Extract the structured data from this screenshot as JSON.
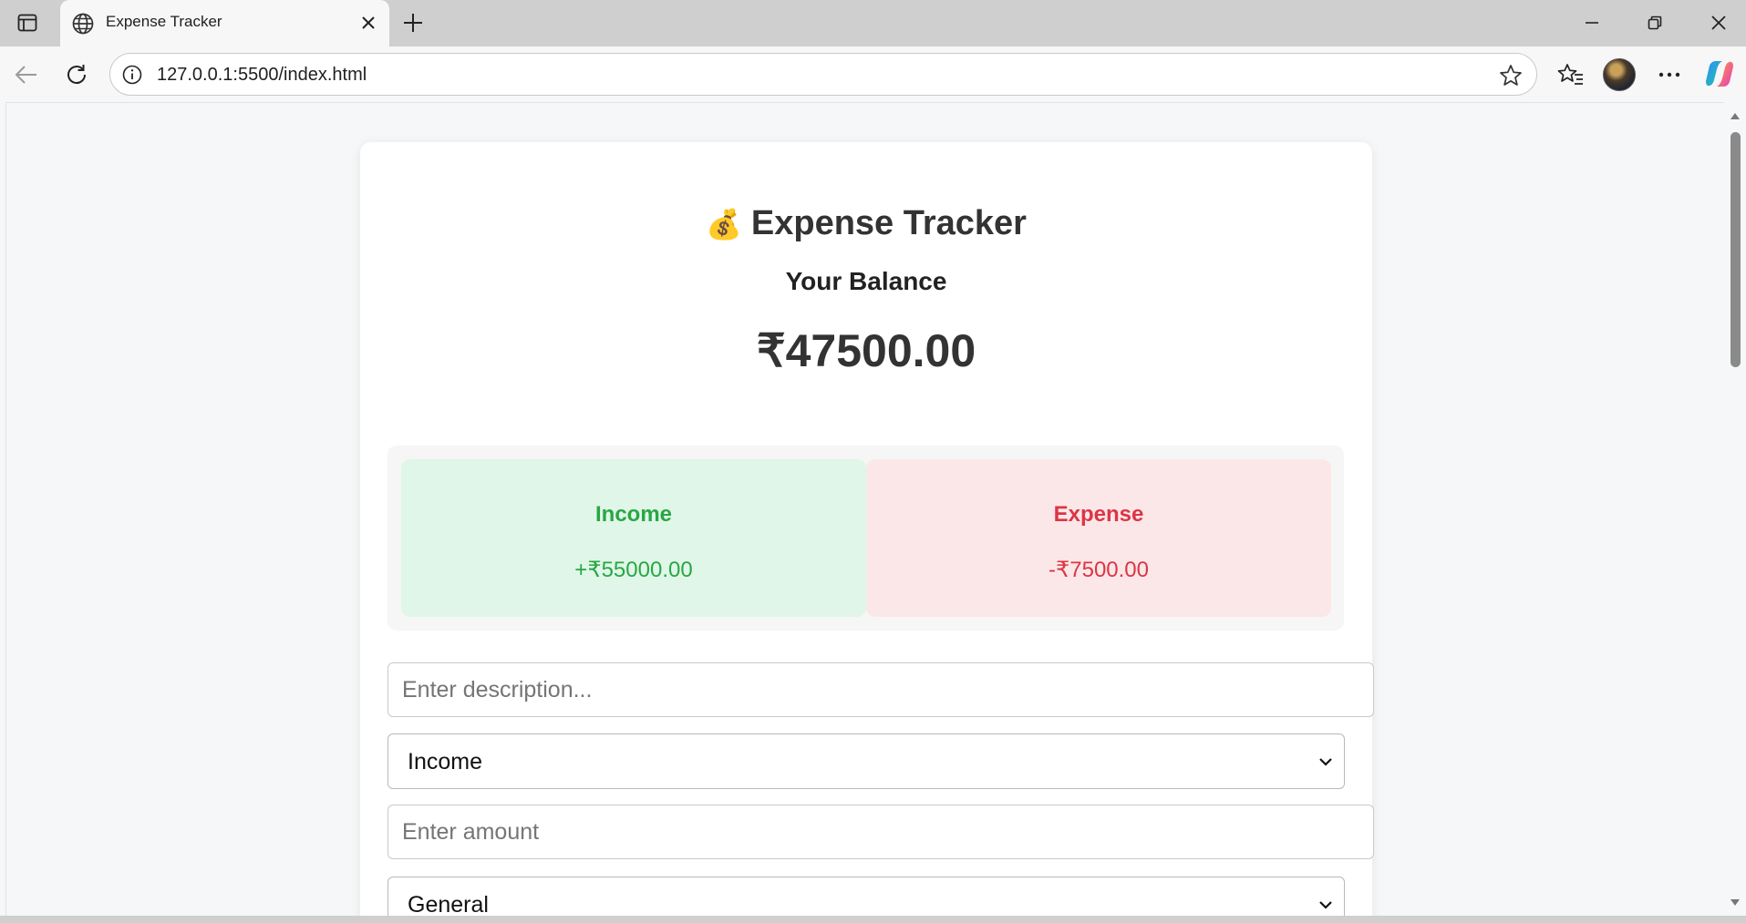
{
  "browser": {
    "tab_title": "Expense Tracker",
    "url": "127.0.0.1:5500/index.html"
  },
  "app": {
    "title": "Expense Tracker",
    "title_icon": "💰",
    "balance_label": "Your Balance",
    "balance_value": "₹47500.00",
    "income_label": "Income",
    "income_value": "+₹55000.00",
    "expense_label": "Expense",
    "expense_value": "-₹7500.00",
    "description_placeholder": "Enter description...",
    "type_selected": "Income",
    "amount_placeholder": "Enter amount",
    "category_selected": "General"
  },
  "colors": {
    "income": "#28a745",
    "expense": "#dc3545",
    "income_bg": "#e0f6e8",
    "expense_bg": "#fce7e8"
  }
}
